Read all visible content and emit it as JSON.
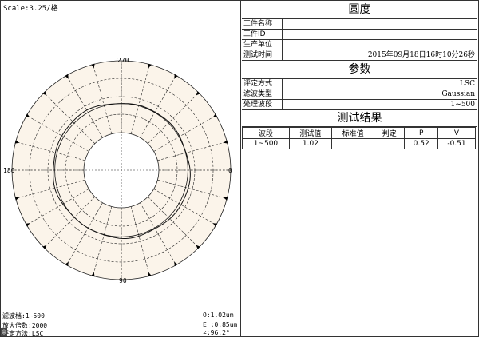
{
  "scale": "Scale:3.25/格",
  "axes": {
    "top": "270",
    "bottom": "90",
    "left": "180",
    "right": "0"
  },
  "bottom_left": [
    "滤波档:1~500",
    "放大倍数:2000",
    "评定方法:LSC"
  ],
  "bottom_right": [
    "O:1.02um",
    "E :0.85um",
    "∠:96.2°"
  ],
  "corner_icon": "米",
  "roundness": {
    "title": "圆度",
    "fields": [
      {
        "key": "工件名称",
        "value": ""
      },
      {
        "key": "工件ID",
        "value": ""
      },
      {
        "key": "生产单位",
        "value": ""
      },
      {
        "key": "测试时间",
        "value": "2015年09月18日16时10分26秒"
      }
    ]
  },
  "params": {
    "title": "参数",
    "fields": [
      {
        "key": "评定方式",
        "value": "LSC"
      },
      {
        "key": "滤波类型",
        "value": "Gaussian"
      },
      {
        "key": "处理波段",
        "value": "1~500"
      }
    ]
  },
  "results": {
    "title": "测试结果",
    "headers": [
      "波段",
      "测试值",
      "标准值",
      "判定",
      "P",
      "V"
    ],
    "rows": [
      [
        "1~500",
        "1.02",
        "",
        "",
        "0.52",
        "-0.51"
      ]
    ]
  },
  "colors": {
    "ring_fill": "#fbf4ea",
    "grid": "#222222",
    "profile": "#111111"
  }
}
